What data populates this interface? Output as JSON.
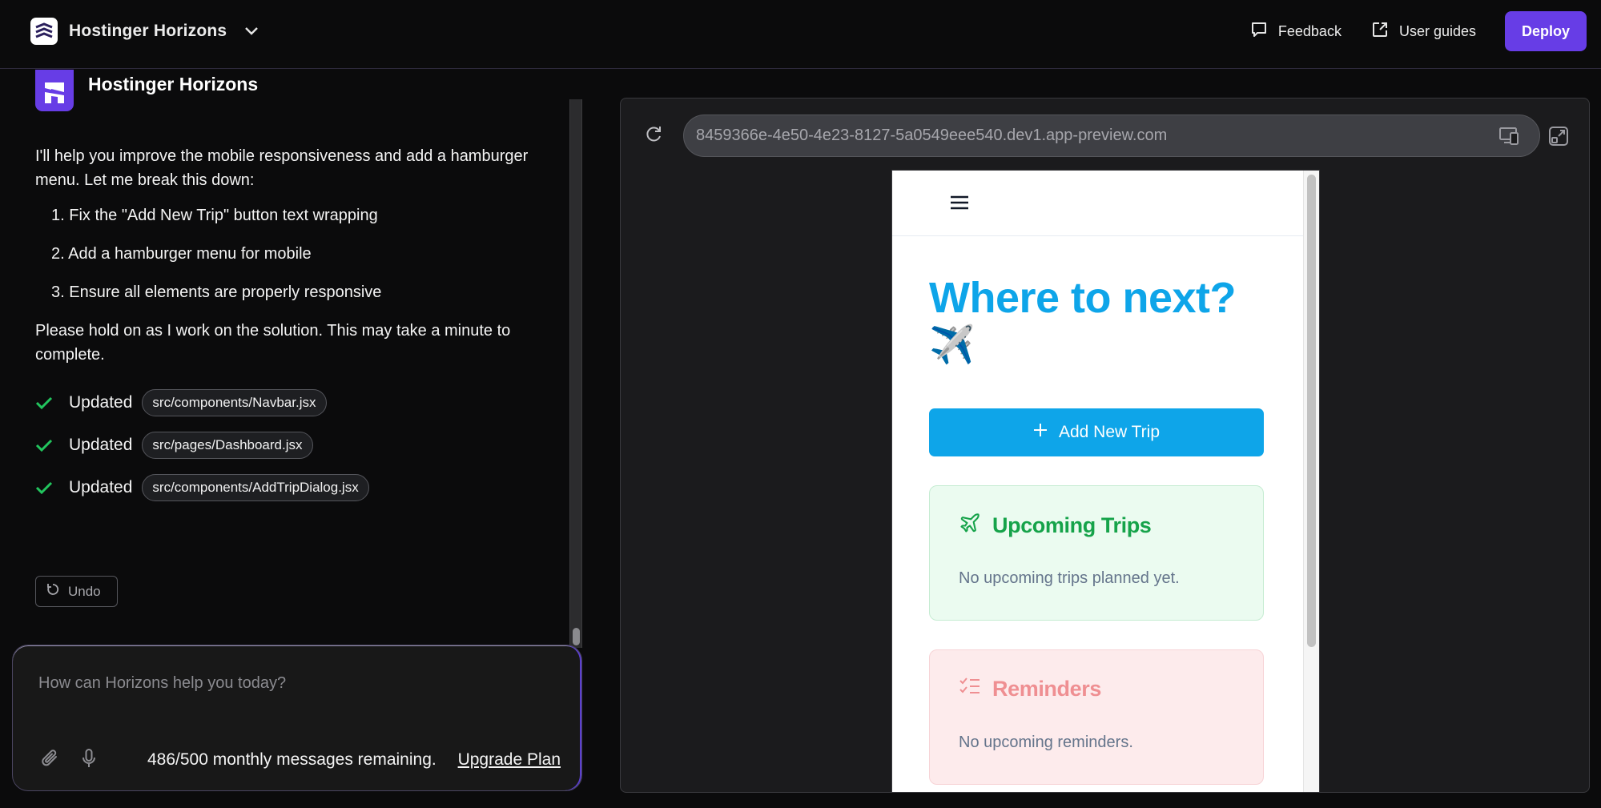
{
  "topbar": {
    "app_name": "Hostinger Horizons",
    "feedback_label": "Feedback",
    "user_guides_label": "User guides",
    "deploy_label": "Deploy"
  },
  "chat": {
    "assistant_name": "Hostinger Horizons",
    "intro": "I'll help you improve the mobile responsiveness and add a hamburger menu. Let me break this down:",
    "steps": [
      "1. Fix the \"Add New Trip\" button text wrapping",
      "2. Add a hamburger menu for mobile",
      "3. Ensure all elements are properly responsive"
    ],
    "outro": "Please hold on as I work on the solution. This may take a minute to complete.",
    "updates": [
      {
        "label": "Updated",
        "file": "src/components/Navbar.jsx"
      },
      {
        "label": "Updated",
        "file": "src/pages/Dashboard.jsx"
      },
      {
        "label": "Updated",
        "file": "src/components/AddTripDialog.jsx"
      }
    ],
    "undo_label": "Undo",
    "scroll_position": 1.0
  },
  "composer": {
    "placeholder": "How can Horizons help you today?",
    "value": "",
    "quota_text": "486/500 monthly messages remaining.",
    "upgrade_label": "Upgrade Plan"
  },
  "preview": {
    "url": "8459366e-4e50-4e23-8127-5a0549eee540.dev1.app-preview.com",
    "app": {
      "hero_title": "Where to next?",
      "hero_emoji": "✈️",
      "add_trip_label": "Add New Trip",
      "cards": [
        {
          "title": "Upcoming Trips",
          "body": "No upcoming trips planned yet.",
          "color": "#16a34a"
        },
        {
          "title": "Reminders",
          "body": "No upcoming reminders.",
          "color": "#ef8f92"
        }
      ]
    }
  },
  "colors": {
    "accent": "#673de6",
    "sky": "#0ea5e9",
    "success": "#22c55e"
  }
}
